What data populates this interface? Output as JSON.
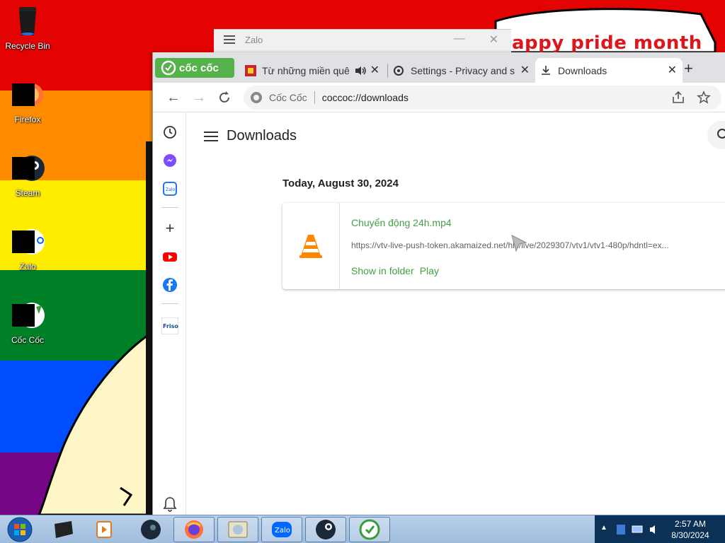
{
  "wallpaper": {
    "banner_text": "appy pride month"
  },
  "desktop_icons": [
    {
      "label": "Recycle Bin"
    },
    {
      "label": "Firefox"
    },
    {
      "label": "Steam"
    },
    {
      "label": "Zalo"
    },
    {
      "label": "Cốc Cốc"
    }
  ],
  "zalo_window": {
    "title": "Zalo"
  },
  "browser": {
    "brand": "cốc cốc",
    "tabs": [
      {
        "title": "Từ những miền quê"
      },
      {
        "title": "Settings - Privacy and s"
      },
      {
        "title": "Downloads",
        "active": true
      }
    ],
    "omnibox": {
      "brand": "Cốc Cốc",
      "url": "coccoc://downloads"
    },
    "sidebar_items": [
      "history",
      "messenger",
      "zalo",
      "add",
      "youtube",
      "facebook",
      "friso",
      "notifications"
    ]
  },
  "downloads_page": {
    "title": "Downloads",
    "date_header": "Today, August 30, 2024",
    "items": [
      {
        "file_name": "Chuyển động 24h.mp4",
        "url": "https://vtv-live-push-token.akamaized.net/hls/live/2029307/vtv1/vtv1-480p/hdntl=ex...",
        "action_show": "Show in folder",
        "action_play": "Play"
      }
    ]
  },
  "taskbar": {
    "time": "2:57 AM",
    "date": "8/30/2024"
  }
}
